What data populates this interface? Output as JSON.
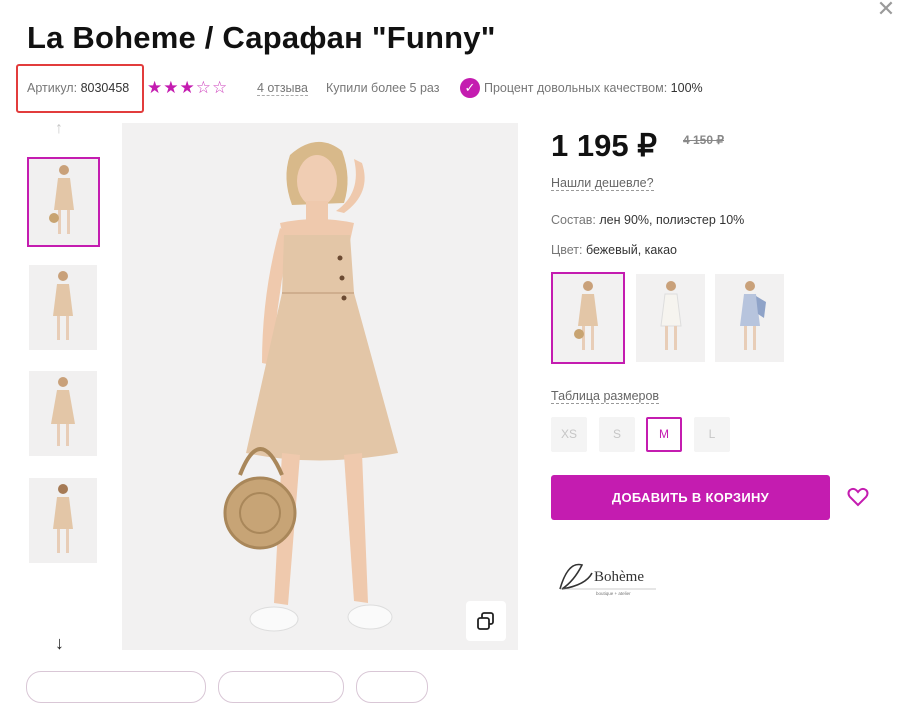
{
  "product": {
    "title": "La Boheme / Сарафан \"Funny\"",
    "article_label": "Артикул:",
    "article_value": "8030458",
    "stars": "★★★",
    "stars_empty": "☆☆",
    "rating": 3,
    "reviews": "4 отзыва",
    "bought": "Купили более 5 раз",
    "satisfaction_label": "Процент довольных качеством:",
    "satisfaction_value": "100%"
  },
  "price": {
    "current": "1 195",
    "currency_symbol": "₽",
    "old": "4 150 ₽",
    "cheaper_link": "Нашли дешевле?"
  },
  "details": {
    "composition_label": "Состав:",
    "composition_value": "лен 90%, полиэстер 10%",
    "color_label": "Цвет:",
    "color_value": "бежевый, какао"
  },
  "sizes": {
    "table_link": "Таблица размеров",
    "options": [
      "XS",
      "S",
      "M",
      "L"
    ],
    "selected": "M"
  },
  "actions": {
    "add_to_cart": "ДОБАВИТЬ В КОРЗИНУ"
  },
  "brand": {
    "logo_text": "La Bohème",
    "logo_sub": "boutique + atelier"
  },
  "icons": {
    "close": "close-icon",
    "check": "check-circle-icon",
    "up": "arrow-up-icon",
    "down": "arrow-down-icon",
    "copy": "copy-icon",
    "heart": "heart-icon"
  },
  "colors": {
    "accent": "#c41cb0",
    "highlight_box": "#e23c3c",
    "dress": "#e3c6a7"
  }
}
